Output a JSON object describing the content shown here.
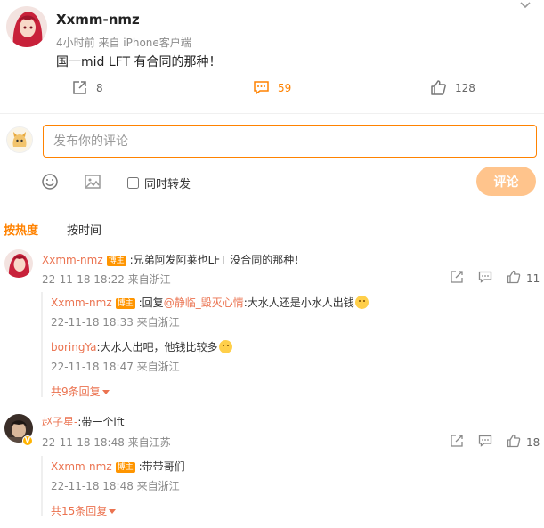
{
  "post": {
    "username": "Xxmm-nmz",
    "meta": "4小时前 来自 iPhone客户端",
    "text": "国一mid LFT 有合同的那种！",
    "repost_count": "8",
    "comment_count": "59",
    "like_count": "128"
  },
  "compose": {
    "placeholder": "发布你的评论",
    "repost_checkbox_label": "同时转发",
    "submit_label": "评论"
  },
  "tabs": {
    "hot": "按热度",
    "time": "按时间"
  },
  "badge_label": "博主",
  "comments": [
    {
      "username": "Xxmm-nmz",
      "text": ":兄弟阿发阿莱也LFT 没合同的那种！",
      "time": "22-11-18 18:22 来自浙江",
      "like_count": "11",
      "replies": [
        {
          "username": "Xxmm-nmz",
          "prefix": ":回复",
          "mention": "@静临_毁灭心情",
          "text": ":大水人还是小水人出钱",
          "time": "22-11-18 18:33 来自浙江",
          "emoji": "thinking-emoji"
        },
        {
          "username": "boringYa",
          "text": ":大水人出吧，他钱比较多",
          "time": "22-11-18 18:47 来自浙江",
          "emoji": "smile-emoji"
        }
      ],
      "more_replies": "共9条回复"
    },
    {
      "username": "赵子星-",
      "text": ":带一个lft",
      "time": "22-11-18 18:48 来自江苏",
      "like_count": "18",
      "replies": [
        {
          "username": "Xxmm-nmz",
          "text": ":带带哥们",
          "time": "22-11-18 18:48 来自浙江"
        }
      ],
      "more_replies": "共15条回复"
    }
  ],
  "colors": {
    "accent": "#ff8200",
    "name": "#eb7350",
    "badge": "#ff9500"
  }
}
